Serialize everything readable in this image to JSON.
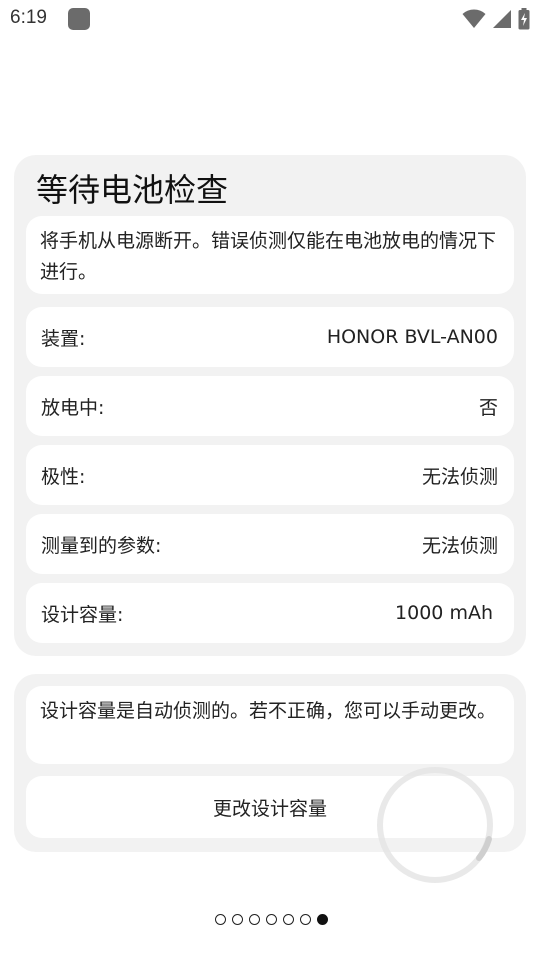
{
  "status_bar": {
    "time": "6:19",
    "icons": [
      "app-notification-icon",
      "wifi-icon",
      "cell-signal-icon",
      "battery-charging-icon"
    ]
  },
  "battery_check": {
    "title": "等待电池检查",
    "notice": "将手机从电源断开。错误侦测仅能在电池放电的情况下进行。",
    "rows": [
      {
        "label": "装置:",
        "value": "HONOR BVL-AN00"
      },
      {
        "label": "放电中:",
        "value": "否"
      },
      {
        "label": "极性:",
        "value": "无法侦测"
      },
      {
        "label": "测量到的参数:",
        "value": "无法侦测"
      },
      {
        "label": "设计容量:",
        "value": "1000 mAh"
      }
    ]
  },
  "capacity": {
    "notice": "设计容量是自动侦测的。若不正确，您可以手动更改。",
    "button_label": "更改设计容量"
  },
  "pager": {
    "total": 7,
    "active_index": 6
  }
}
